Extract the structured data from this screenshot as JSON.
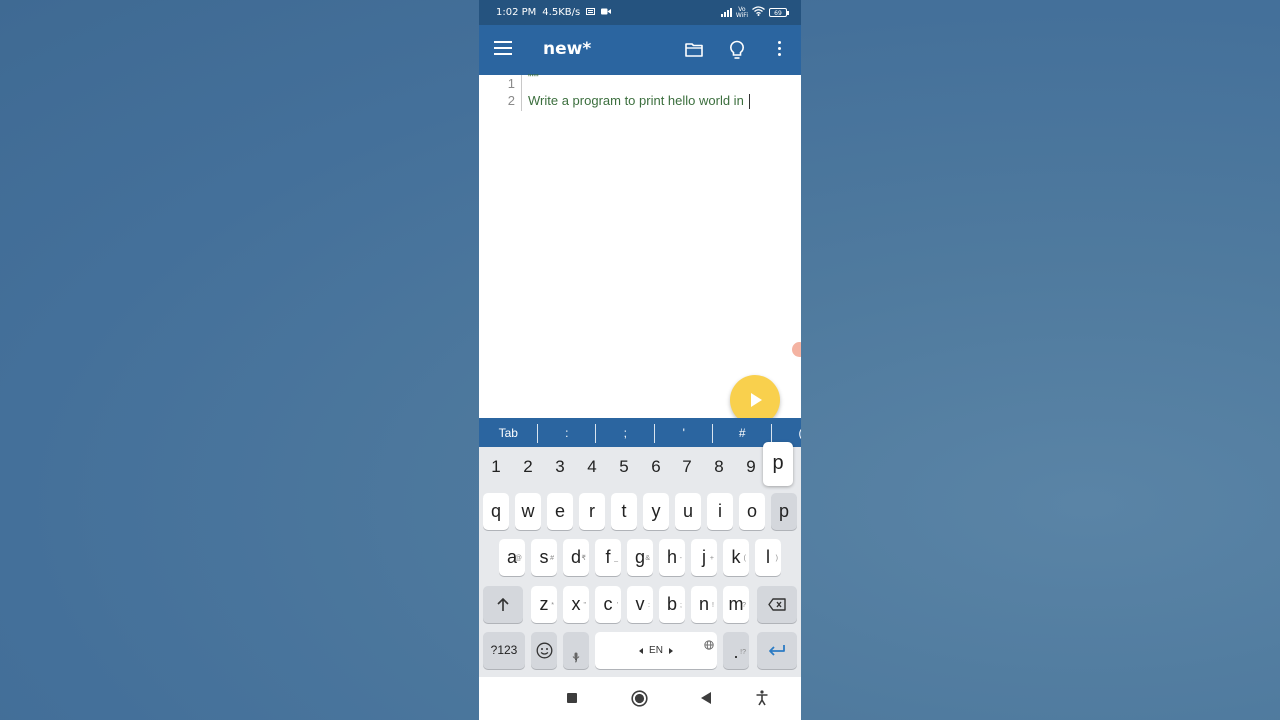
{
  "status_bar": {
    "time": "1:02 PM",
    "net_speed": "4.5KB/s",
    "vowifi_top": "Vo",
    "vowifi_bottom": "WiFi",
    "battery": "69"
  },
  "app_bar": {
    "title": "new*"
  },
  "editor": {
    "lines": [
      {
        "number": "1",
        "text": "\"\"\""
      },
      {
        "number": "2",
        "text": "Write a program to print hello world in "
      }
    ]
  },
  "symbol_bar": [
    "Tab",
    ":",
    ";",
    "'",
    "#",
    "("
  ],
  "keyboard": {
    "numbers": [
      "1",
      "2",
      "3",
      "4",
      "5",
      "6",
      "7",
      "8",
      "9"
    ],
    "row1": [
      "q",
      "w",
      "e",
      "r",
      "t",
      "y",
      "u",
      "i",
      "o",
      "p"
    ],
    "row2": [
      "a",
      "s",
      "d",
      "f",
      "g",
      "h",
      "j",
      "k",
      "l"
    ],
    "row2_hints": [
      "@",
      "#",
      "₹",
      "_",
      "&",
      "-",
      "+",
      "(",
      ")"
    ],
    "row3": [
      "z",
      "x",
      "c",
      "v",
      "b",
      "n",
      "m"
    ],
    "row3_hints": [
      "*",
      "\"",
      "'",
      ":",
      ";",
      "!",
      "?"
    ],
    "symbols_key": "?123",
    "comma": ",",
    "space_label": "EN",
    "period": ".",
    "period_hint": "!?",
    "preview": "p"
  },
  "colors": {
    "status_bar": "#25537f",
    "app_bar": "#2b65a0",
    "fab": "#f9d04d",
    "code_text": "#3b6e3d"
  }
}
